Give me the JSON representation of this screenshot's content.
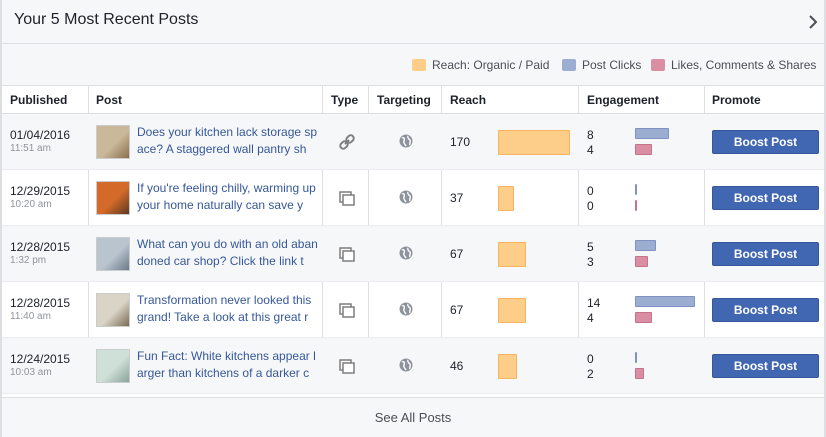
{
  "header": {
    "title": "Your 5 Most Recent Posts"
  },
  "legend": {
    "reach": {
      "label": "Reach: Organic / Paid",
      "color": "#fdce8a"
    },
    "clicks": {
      "label": "Post Clicks",
      "color": "#9cadd2"
    },
    "likes": {
      "label": "Likes, Comments & Shares",
      "color": "#d98ea3"
    }
  },
  "columns": {
    "published": "Published",
    "post": "Post",
    "type": "Type",
    "targeting": "Targeting",
    "reach": "Reach",
    "engagement": "Engagement",
    "promote": "Promote"
  },
  "rows": [
    {
      "date": "01/04/2016",
      "time": "11:51 am",
      "text": "Does your kitchen lack storage space? A staggered wall pantry sh",
      "type": "link-icon",
      "targeting": "globe-icon",
      "reach": 170,
      "clicks": 8,
      "likes": 4,
      "boost": "Boost Post"
    },
    {
      "date": "12/29/2015",
      "time": "10:20 am",
      "text": "If you're feeling chilly, warming up your home naturally can save y",
      "type": "photo-icon",
      "targeting": "globe-icon",
      "reach": 37,
      "clicks": 0,
      "likes": 0,
      "boost": "Boost Post"
    },
    {
      "date": "12/28/2015",
      "time": "1:32 pm",
      "text": "What can you do with an old abandoned car shop? Click the link t",
      "type": "photo-icon",
      "targeting": "globe-icon",
      "reach": 67,
      "clicks": 5,
      "likes": 3,
      "boost": "Boost Post"
    },
    {
      "date": "12/28/2015",
      "time": "11:40 am",
      "text": "Transformation never looked this grand! Take a look at this great r",
      "type": "photo-icon",
      "targeting": "globe-icon",
      "reach": 67,
      "clicks": 14,
      "likes": 4,
      "boost": "Boost Post"
    },
    {
      "date": "12/24/2015",
      "time": "10:03 am",
      "text": "Fun Fact: White kitchens appear larger than kitchens of a darker c",
      "type": "photo-icon",
      "targeting": "globe-icon",
      "reach": 46,
      "clicks": 0,
      "likes": 2,
      "boost": "Boost Post"
    }
  ],
  "footer": {
    "link": "See All Posts"
  }
}
